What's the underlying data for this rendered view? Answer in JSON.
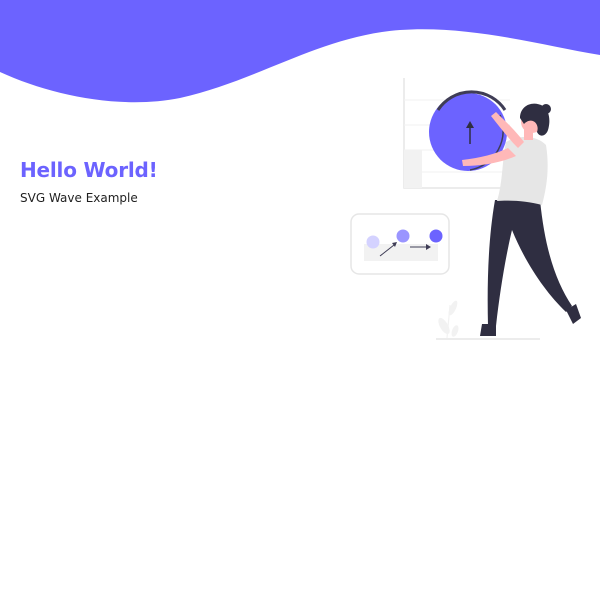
{
  "colors": {
    "accent": "#6c63ff",
    "text_dark": "#1f1f1f",
    "figure_dark": "#2f2e41",
    "skin": "#ffb8b8",
    "shirt": "#e6e6e6",
    "light_gray": "#f2f2f2",
    "background": "#ffffff"
  },
  "hero": {
    "title": "Hello World!",
    "subtitle": "SVG Wave Example"
  },
  "illustration": {
    "icon": "woman-with-growth-chart-illustration",
    "elements": [
      "growth-chart-circle-icon",
      "up-arrow-icon",
      "progress-steps-card",
      "plant-icon"
    ]
  }
}
